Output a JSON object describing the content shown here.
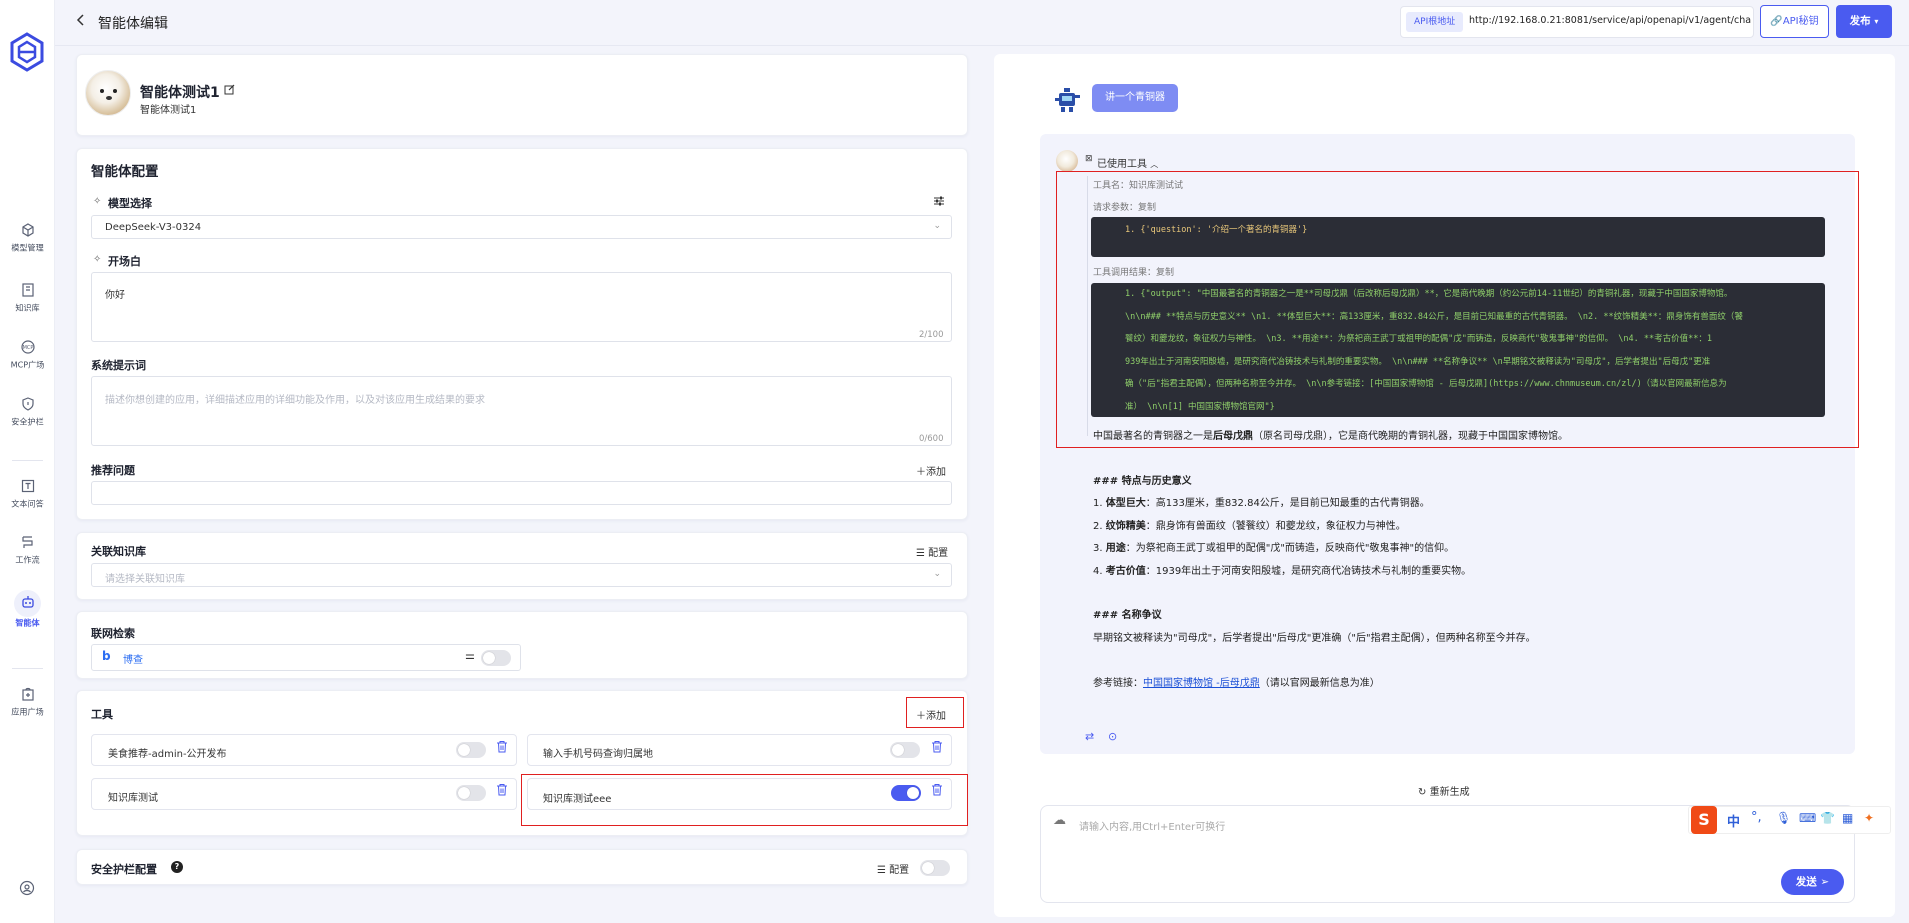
{
  "header": {
    "back_icon": "chevron-left-icon",
    "title": "智能体编辑",
    "api_label": "API根地址",
    "api_url": "http://192.168.0.21:8081/service/api/openapi/v1/agent/chat",
    "api_key_label": "API秘钥",
    "publish_label": "发布"
  },
  "nav": {
    "items": [
      {
        "label": "模型管理",
        "icon": "cube-icon"
      },
      {
        "label": "知识库",
        "icon": "book-icon"
      },
      {
        "label": "MCP广场",
        "icon": "mcp-icon"
      },
      {
        "label": "安全护栏",
        "icon": "shield-icon"
      },
      {
        "label": "文本问答",
        "icon": "text-icon"
      },
      {
        "label": "工作流",
        "icon": "workflow-icon"
      },
      {
        "label": "智能体",
        "icon": "robot-icon"
      },
      {
        "label": "应用广场",
        "icon": "app-store-icon"
      }
    ],
    "active": "智能体"
  },
  "agent": {
    "name": "智能体测试1",
    "desc": "智能体测试1"
  },
  "config": {
    "title": "智能体配置",
    "model_label": "模型选择",
    "model_value": "DeepSeek-V3-0324",
    "opening_label": "开场白",
    "opening_value": "你好",
    "opening_counter": "2/100",
    "system_label": "系统提示词",
    "system_placeholder": "描述你想创建的应用，详细描述应用的详细功能及作用，以及对该应用生成结果的要求",
    "system_counter": "0/600",
    "suggest_label": "推荐问题",
    "add_label": "添加"
  },
  "kb": {
    "title": "关联知识库",
    "config_label": "配置",
    "placeholder": "请选择关联知识库"
  },
  "web": {
    "title": "联网检索",
    "engine": "博查",
    "enabled": 0
  },
  "tools": {
    "title": "工具",
    "add_label": "添加",
    "items": [
      {
        "name": "美食推荐-admin-公开发布",
        "enabled": 0
      },
      {
        "name": "输入手机号码查询归属地",
        "enabled": 0
      },
      {
        "name": "知识库测试",
        "enabled": 0
      },
      {
        "name": "知识库测试eee",
        "enabled": 1
      }
    ]
  },
  "guard": {
    "title": "安全护栏配置",
    "config_label": "配置"
  },
  "chat": {
    "user_msg": "讲一个青铜器",
    "used_tools": "已使用工具",
    "tool_name_line": "工具名：知识库测试试",
    "req_label": "请求参数：",
    "copy_label": "复制",
    "req_code": "1.  {'question': '介绍一个著名的青铜器'}",
    "res_label": "工具调用结果：",
    "res_lines": [
      "1.  {\"output\": \"中国最著名的青铜器之一是**司母戊鼎（后改称后母戊鼎）**，它是商代晚期（约公元前14-11世纪）的青铜礼器，现藏于中国国家博物馆。",
      "\\n\\n### **特点与历史意义**  \\n1. **体型巨大**：高133厘米，重832.84公斤，是目前已知最重的古代青铜器。  \\n2. **纹饰精美**：鼎身饰有兽面纹（饕",
      "餮纹）和夔龙纹，象征权力与神性。  \\n3. **用途**：为祭祀商王武丁或祖甲的配偶\"戊\"而铸造，反映商代\"敬鬼事神\"的信仰。  \\n4. **考古价值**：1",
      "939年出土于河南安阳殷墟，是研究商代冶铸技术与礼制的重要实物。  \\n\\n### **名称争议**  \\n早期铭文被释读为\"司母戊\"，后学者提出\"后母戊\"更准",
      "确（\"后\"指君主配偶），但两种名称至今并存。  \\n\\n参考链接：[中国国家博物馆 - 后母戊鼎](https://www.chnmuseum.cn/zl/)（请以官网最新信息为",
      "准）  \\n\\n[1] 中国国家博物馆官网\"}"
    ],
    "answer_intro_pre": "中国最著名的青铜器之一是",
    "answer_intro_bold": "后母戊鼎",
    "answer_intro_post": "（原名司母戊鼎），它是商代晚期的青铜礼器，现藏于中国国家博物馆。",
    "h1": "### 特点与历史意义",
    "points": [
      {
        "n": "1.",
        "b": "体型巨大",
        "t": "：高133厘米，重832.84公斤，是目前已知最重的古代青铜器。"
      },
      {
        "n": "2.",
        "b": "纹饰精美",
        "t": "：鼎身饰有兽面纹（饕餮纹）和夔龙纹，象征权力与神性。"
      },
      {
        "n": "3.",
        "b": "用途",
        "t": "：为祭祀商王武丁或祖甲的配偶\"戊\"而铸造，反映商代\"敬鬼事神\"的信仰。"
      },
      {
        "n": "4.",
        "b": "考古价值",
        "t": "：1939年出土于河南安阳殷墟，是研究商代冶铸技术与礼制的重要实物。"
      }
    ],
    "h2": "### 名称争议",
    "name_text": "早期铭文被释读为\"司母戊\"，后学者提出\"后母戊\"更准确（\"后\"指君主配偶），但两种名称至今并存。",
    "ref_pre": "参考链接：",
    "ref_link": "中国国家博物馆 -后母戊鼎",
    "ref_post": "（请以官网最新信息为准）",
    "regen_label": "重新生成",
    "input_placeholder": "请输入内容,用Ctrl+Enter可换行",
    "send_label": "发送"
  },
  "colors": {
    "accent": "#4a5bf0",
    "highlight": "#e02020",
    "code_bg": "#2b2d36"
  }
}
